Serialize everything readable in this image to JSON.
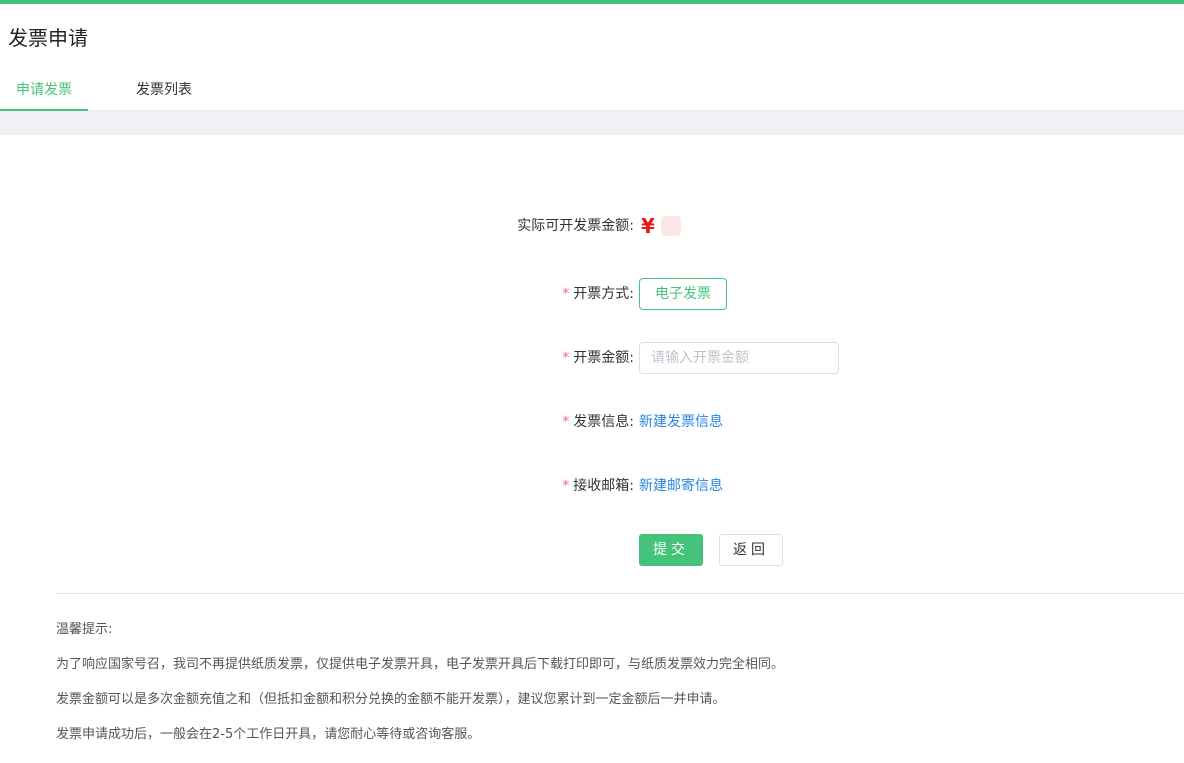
{
  "page": {
    "title": "发票申请"
  },
  "tabs": [
    {
      "label": "申请发票",
      "active": true
    },
    {
      "label": "发票列表",
      "active": false
    }
  ],
  "form": {
    "available": {
      "label": "实际可开发票金额:",
      "currency": "¥"
    },
    "invoice_type": {
      "required_mark": "*",
      "label": "开票方式:",
      "option": "电子发票"
    },
    "amount": {
      "required_mark": "*",
      "label": "开票金额:",
      "value": "",
      "placeholder": "请输入开票金额"
    },
    "invoice_info": {
      "required_mark": "*",
      "label": "发票信息:",
      "link": "新建发票信息"
    },
    "email": {
      "required_mark": "*",
      "label": "接收邮箱:",
      "link": "新建邮寄信息"
    }
  },
  "actions": {
    "submit": "提交",
    "back": "返回"
  },
  "tips": {
    "title": "温馨提示:",
    "lines": [
      "为了响应国家号召，我司不再提供纸质发票，仅提供电子发票开具，电子发票开具后下载打印即可，与纸质发票效力完全相同。",
      "发票金额可以是多次金额充值之和（但抵扣金额和积分兑换的金额不能开发票），建议您累计到一定金额后一并申请。",
      "发票申请成功后，一般会在2-5个工作日开具，请您耐心等待或咨询客服。"
    ]
  },
  "colors": {
    "accent": "#46c37b",
    "link": "#2b85e4",
    "required": "#f56c6c",
    "currency": "#e21b1b"
  }
}
